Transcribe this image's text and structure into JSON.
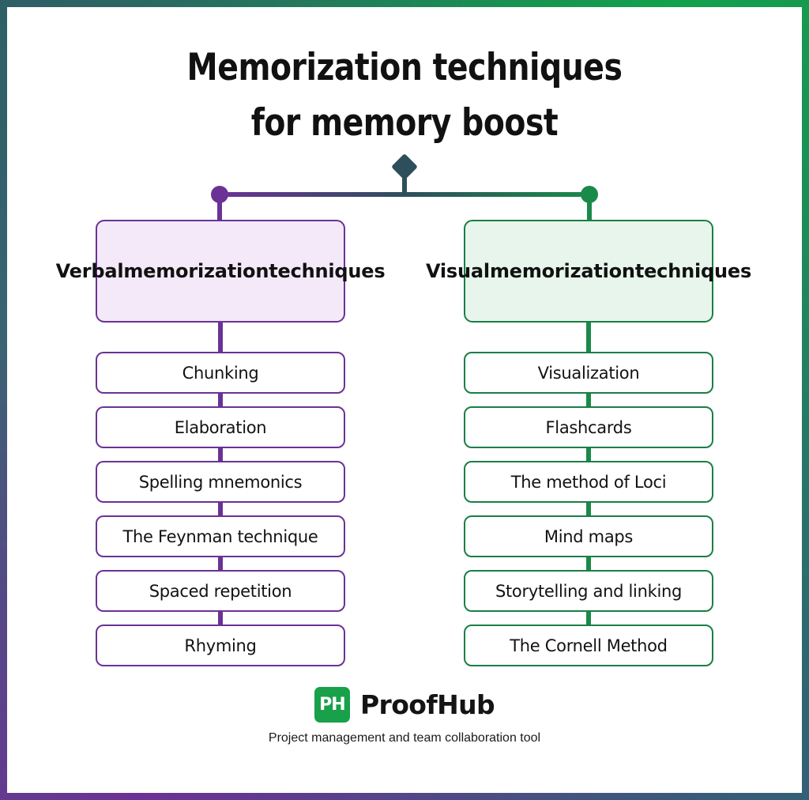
{
  "title": {
    "line1": "Memorization techniques",
    "line2": "for memory boost"
  },
  "colors": {
    "verbal_accent": "#6b3296",
    "verbal_fill": "#f4e9f8",
    "visual_accent": "#1a7f46",
    "visual_fill": "#e7f5ec",
    "connector_diamond": "#2d4f5c",
    "frame_teal": "#2e5f66",
    "frame_green": "#12a14c",
    "frame_purple": "#6b3296",
    "logo_green": "#18a04a",
    "background": "#ffffff"
  },
  "connector": {
    "diamond_name": "root-diamond-node",
    "left_node_name": "verbal-branch-node",
    "right_node_name": "visual-branch-node"
  },
  "branches": [
    {
      "key": "verbal",
      "heading": "Verbal\nmemorization\ntechniques",
      "heading_lines": [
        "Verbal",
        "memorization",
        "techniques"
      ],
      "items": [
        "Chunking",
        "Elaboration",
        "Spelling mnemonics",
        "The Feynman technique",
        "Spaced repetition",
        "Rhyming"
      ]
    },
    {
      "key": "visual",
      "heading": "Visual\nmemorization\ntechniques",
      "heading_lines": [
        "Visual",
        "memorization",
        "techniques"
      ],
      "items": [
        "Visualization",
        "Flashcards",
        "The method of Loci",
        "Mind maps",
        "Storytelling and linking",
        "The Cornell Method"
      ]
    }
  ],
  "footer": {
    "logo_text": "PH",
    "brand": "ProofHub",
    "tagline": "Project management and team collaboration tool"
  }
}
